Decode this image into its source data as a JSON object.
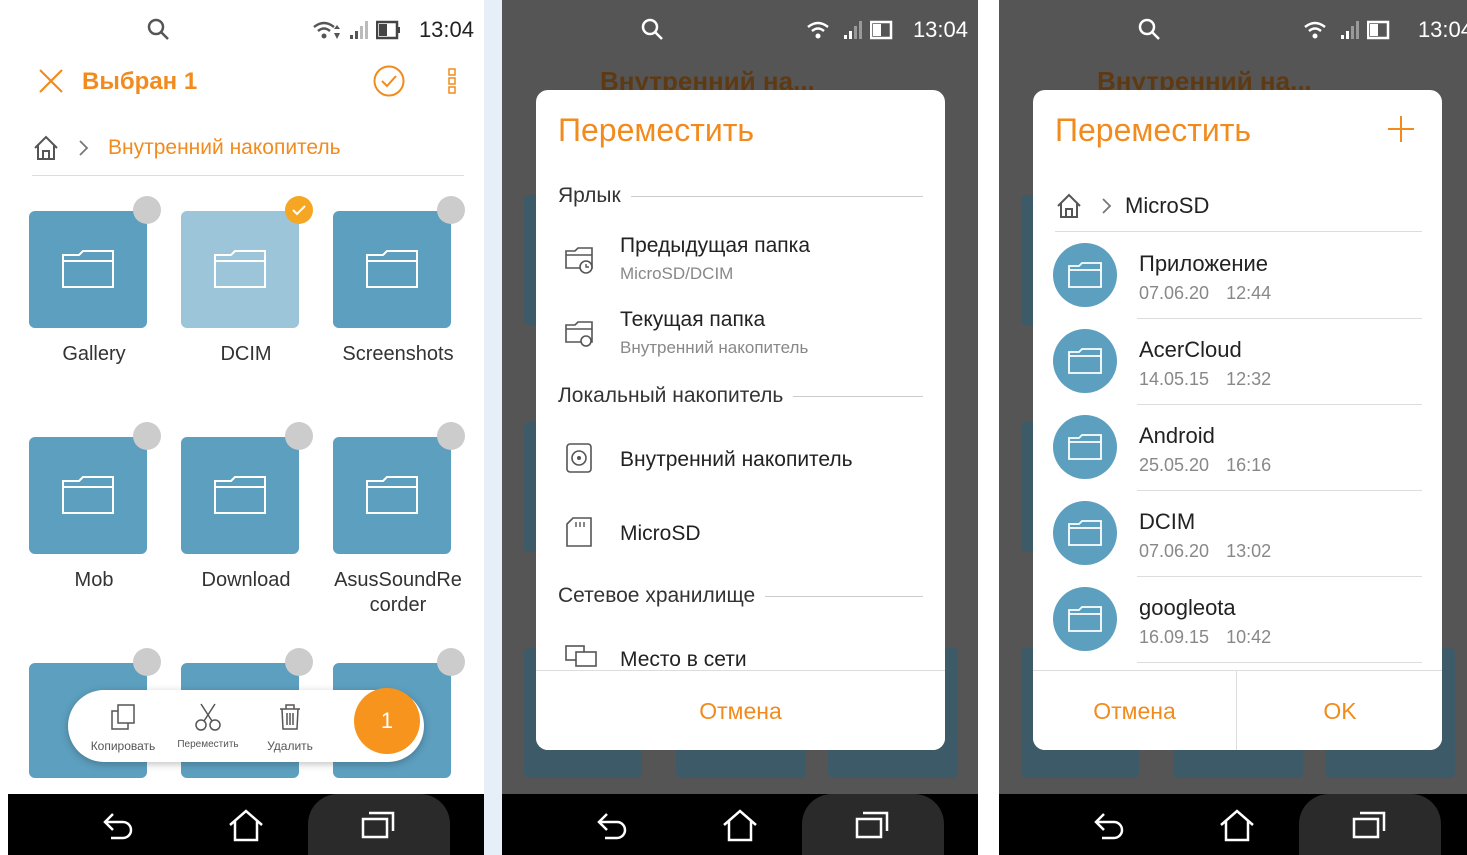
{
  "status": {
    "time": "13:04"
  },
  "panel1": {
    "title": "Выбран 1",
    "breadcrumb": "Внутренний накопитель",
    "folders": [
      {
        "label": "Gallery",
        "selected": false
      },
      {
        "label": "DCIM",
        "selected": true
      },
      {
        "label": "Screenshots",
        "selected": false
      },
      {
        "label": "Mob",
        "selected": false
      },
      {
        "label": "Download",
        "selected": false
      },
      {
        "label": "AsusSoundRe corder",
        "selected": false
      }
    ],
    "actions": {
      "copy": "Копировать",
      "move": "Переместить",
      "delete": "Удалить",
      "count": "1"
    }
  },
  "panel2": {
    "bg_title": "Внутренний на...",
    "dialog_title": "Переместить",
    "section_shortcut": "Ярлык",
    "prev_folder": "Предыдущая папка",
    "prev_folder_path": "MicroSD/DCIM",
    "current_folder": "Текущая папка",
    "current_folder_path": "Внутренний накопитель",
    "section_local": "Локальный накопитель",
    "internal": "Внутренний накопитель",
    "microsd": "MicroSD",
    "section_network": "Сетевое хранилище",
    "network_place": "Место в сети",
    "cancel": "Отмена"
  },
  "panel3": {
    "bg_title": "Внутренний на...",
    "dialog_title": "Переместить",
    "breadcrumb": "MicroSD",
    "files": [
      {
        "name": "Приложение",
        "date": "07.06.20 12:44"
      },
      {
        "name": "AcerCloud",
        "date": "14.05.15 12:32"
      },
      {
        "name": "Android",
        "date": "25.05.20 16:16"
      },
      {
        "name": "DCIM",
        "date": "07.06.20 13:02"
      },
      {
        "name": "googleota",
        "date": "16.09.15 10:42"
      }
    ],
    "cancel": "Отмена",
    "ok": "OK"
  }
}
